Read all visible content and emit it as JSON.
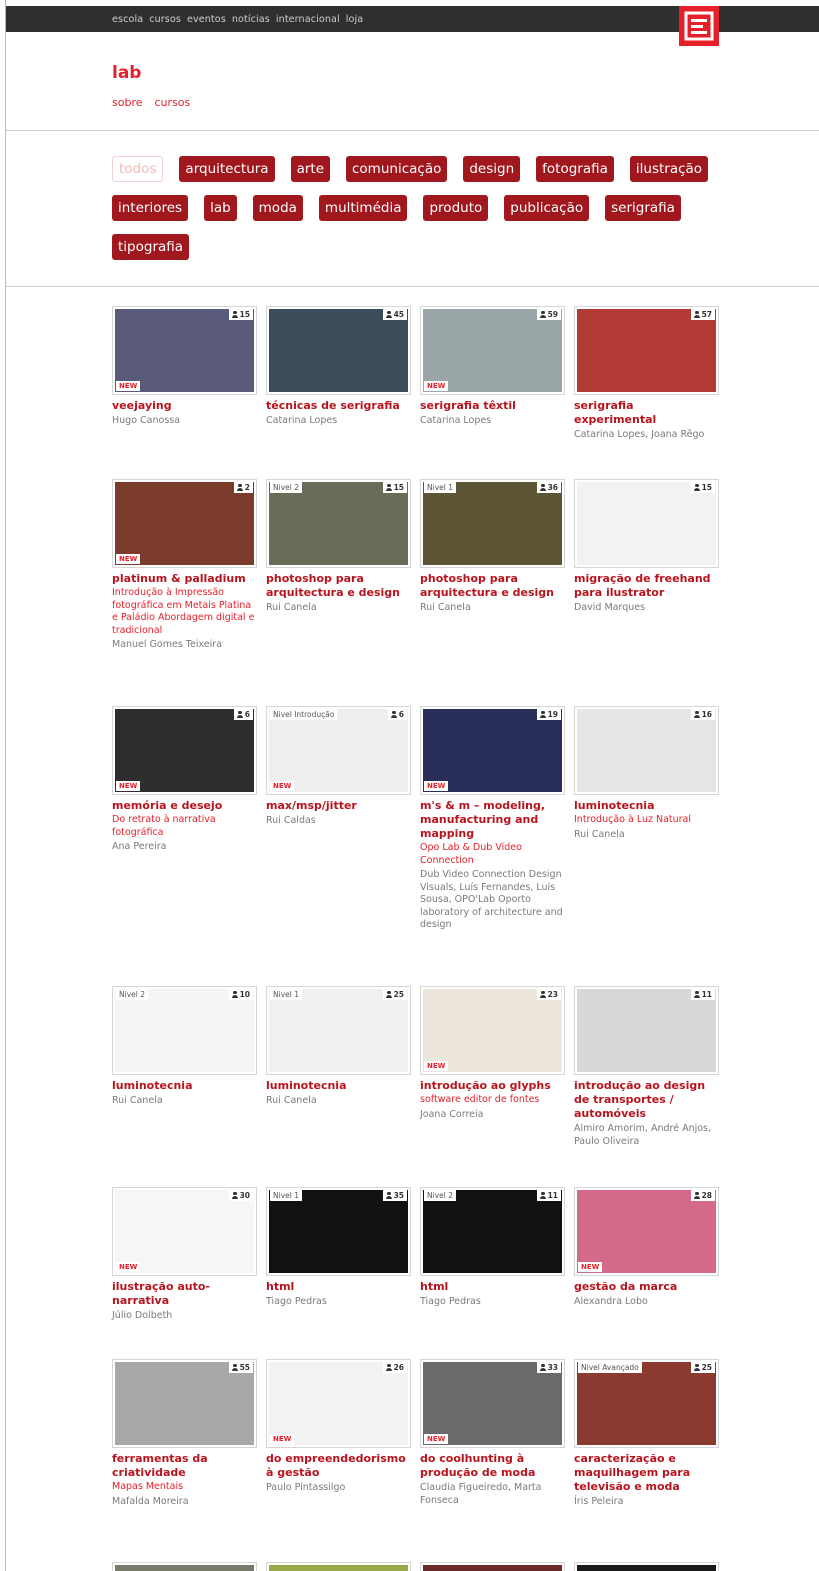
{
  "topnav": [
    "escola",
    "cursos",
    "eventos",
    "notícias",
    "internacional",
    "loja"
  ],
  "brand": {
    "color": "#e6202a",
    "logo_icon": "e-logo-icon"
  },
  "section": {
    "title": "lab",
    "subnav": [
      "sobre",
      "cursos"
    ]
  },
  "tags": [
    {
      "label": "todos",
      "active": false
    },
    {
      "label": "arquitectura",
      "active": true
    },
    {
      "label": "arte",
      "active": true
    },
    {
      "label": "comunicação",
      "active": true
    },
    {
      "label": "design",
      "active": true
    },
    {
      "label": "fotografia",
      "active": true
    },
    {
      "label": "ilustração",
      "active": true
    },
    {
      "label": "interiores",
      "active": true
    },
    {
      "label": "lab",
      "active": true
    },
    {
      "label": "moda",
      "active": true
    },
    {
      "label": "multimédia",
      "active": true
    },
    {
      "label": "produto",
      "active": true
    },
    {
      "label": "publicação",
      "active": true
    },
    {
      "label": "serigrafia",
      "active": true
    },
    {
      "label": "tipografia",
      "active": true
    }
  ],
  "courses": [
    {
      "title": "veejaying",
      "author": "Hugo Canossa",
      "count": "15",
      "new": "NEW",
      "level": "",
      "subtitle": "",
      "img_color": "#5a5a7a"
    },
    {
      "title": "técnicas de serigrafia",
      "author": "Catarina Lopes",
      "count": "45",
      "new": "",
      "level": "",
      "subtitle": "",
      "img_color": "#3c4c5a"
    },
    {
      "title": "serigrafia têxtil",
      "author": "Catarina Lopes",
      "count": "59",
      "new": "NEW",
      "level": "",
      "subtitle": "",
      "img_color": "#9aa6a8"
    },
    {
      "title": "serigrafia experimental",
      "author": "Catarina Lopes, Joana Rêgo",
      "count": "57",
      "new": "",
      "level": "",
      "subtitle": "",
      "img_color": "#b23b36"
    },
    {
      "title": "platinum & palladium",
      "author": "Manuel Gomes Teixeira",
      "count": "2",
      "new": "NEW",
      "level": "",
      "subtitle": "Introdução à Impressão fotográfica em Metais Platina e Paládio Abordagem digital e tradicional",
      "img_color": "#7a3b2a"
    },
    {
      "title": "photoshop para arquitectura e design",
      "author": "Rui Canela",
      "count": "15",
      "new": "",
      "level": "Nivel 2",
      "subtitle": "",
      "img_color": "#6b6b5a"
    },
    {
      "title": "photoshop para arquitectura e design",
      "author": "Rui Canela",
      "count": "36",
      "new": "",
      "level": "Nivel 1",
      "subtitle": "",
      "img_color": "#5e5436"
    },
    {
      "title": "migração de freehand para ilustrator",
      "author": "David Marques",
      "count": "15",
      "new": "",
      "level": "",
      "subtitle": "",
      "img_color": "#f2f2f2"
    },
    {
      "title": "memória e desejo",
      "author": "Ana Pereira",
      "count": "6",
      "new": "NEW",
      "level": "",
      "subtitle": "Do retrato à narrativa fotográfica",
      "img_color": "#2e2e2e"
    },
    {
      "title": "max/msp/jitter",
      "author": "Rui Caldas",
      "count": "6",
      "new": "NEW",
      "level": "Nivel Introdução",
      "subtitle": "",
      "img_color": "#eeeeee"
    },
    {
      "title": "m's & m – modeling, manufacturing and mapping",
      "author": "Dub Video Connection Design Visuals, Luís Fernandes, Luís Sousa, OPO'Lab Oporto laboratory of architecture and design",
      "count": "19",
      "new": "NEW",
      "level": "",
      "subtitle": "Opo Lab & Dub Video Connection",
      "img_color": "#2a2f5a"
    },
    {
      "title": "luminotecnia",
      "author": "Rui Canela",
      "count": "16",
      "new": "",
      "level": "",
      "subtitle": "Introdução à Luz Natural",
      "img_color": "#e6e6e6"
    },
    {
      "title": "luminotecnia",
      "author": "Rui Canela",
      "count": "10",
      "new": "",
      "level": "Nivel 2",
      "subtitle": "",
      "img_color": "#f4f4f4"
    },
    {
      "title": "luminotecnia",
      "author": "Rui Canela",
      "count": "25",
      "new": "",
      "level": "Nivel 1",
      "subtitle": "",
      "img_color": "#f0f0f0"
    },
    {
      "title": "introdução ao glyphs",
      "author": "Joana Correia",
      "count": "23",
      "new": "NEW",
      "level": "",
      "subtitle": "software editor de fontes",
      "img_color": "#ece6dc"
    },
    {
      "title": "introdução ao design de transportes / automóveis",
      "author": "Almiro Amorim, André Anjos, Paulo Oliveira",
      "count": "11",
      "new": "",
      "level": "",
      "subtitle": "",
      "img_color": "#d8d8d8"
    },
    {
      "title": "ilustração auto-narrativa",
      "author": "Júlio Dolbeth",
      "count": "30",
      "new": "NEW",
      "level": "",
      "subtitle": "",
      "img_color": "#f6f6f6"
    },
    {
      "title": "html",
      "author": "Tiago Pedras",
      "count": "35",
      "new": "",
      "level": "Nivel 1",
      "subtitle": "",
      "img_color": "#111111"
    },
    {
      "title": "html",
      "author": "Tiago Pedras",
      "count": "11",
      "new": "",
      "level": "Nivel 2",
      "subtitle": "",
      "img_color": "#111111"
    },
    {
      "title": "gestão da marca",
      "author": "Alexandra Lobo",
      "count": "28",
      "new": "NEW",
      "level": "",
      "subtitle": "",
      "img_color": "#d46a8a"
    },
    {
      "title": "ferramentas da criatividade",
      "author": "Mafalda Moreira",
      "count": "55",
      "new": "",
      "level": "",
      "subtitle": "Mapas Mentais",
      "img_color": "#a8a8a8"
    },
    {
      "title": "do empreendedorismo à gestão",
      "author": "Paulo Pintassilgo",
      "count": "26",
      "new": "NEW",
      "level": "",
      "subtitle": "",
      "img_color": "#f2f2f2"
    },
    {
      "title": "do coolhunting à produção de moda",
      "author": "Claudia Figueiredo, Marta Fonseca",
      "count": "33",
      "new": "NEW",
      "level": "",
      "subtitle": "",
      "img_color": "#6a6a6a"
    },
    {
      "title": "caracterização e maquilhagem para televisão e moda",
      "author": "Íris Peleira",
      "count": "25",
      "new": "",
      "level": "Nivel Avançado",
      "subtitle": "",
      "img_color": "#8a3a2e"
    }
  ]
}
